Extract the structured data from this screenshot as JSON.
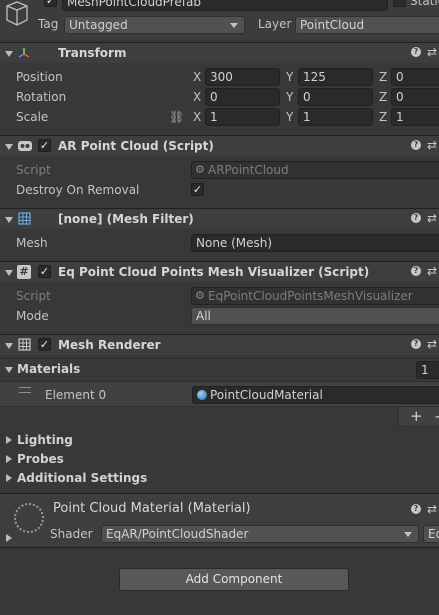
{
  "object": {
    "name": "MeshPointCloudPrefab",
    "static_label": "Static",
    "tag_label": "Tag",
    "tag_value": "Untagged",
    "layer_label": "Layer",
    "layer_value": "PointCloud"
  },
  "transform": {
    "title": "Transform",
    "position_label": "Position",
    "rotation_label": "Rotation",
    "scale_label": "Scale",
    "x": "X",
    "y": "Y",
    "z": "Z",
    "position": [
      "300",
      "125",
      "0"
    ],
    "rotation": [
      "0",
      "0",
      "0"
    ],
    "scale": [
      "1",
      "1",
      "1"
    ]
  },
  "ar_point_cloud": {
    "title": "AR Point Cloud (Script)",
    "script_label": "Script",
    "script_value": "ARPointCloud",
    "destroy_label": "Destroy On Removal",
    "destroy_checked": "✓"
  },
  "mesh_filter": {
    "title": "[none] (Mesh Filter)",
    "mesh_label": "Mesh",
    "mesh_value": "None (Mesh)"
  },
  "visualizer": {
    "title": "Eq Point Cloud Points Mesh Visualizer (Script)",
    "script_label": "Script",
    "script_value": "EqPointCloudPointsMeshVisualizer",
    "mode_label": "Mode",
    "mode_value": "All"
  },
  "mesh_renderer": {
    "title": "Mesh Renderer",
    "materials_label": "Materials",
    "materials_count": "1",
    "element_label": "Element 0",
    "element_value": "PointCloudMaterial",
    "add": "+",
    "remove": "-",
    "lighting": "Lighting",
    "probes": "Probes",
    "additional": "Additional Settings"
  },
  "material": {
    "title": "Point Cloud Material (Material)",
    "shader_label": "Shader",
    "shader_value": "EqAR/PointCloudShader",
    "edit": "Ed"
  },
  "add_component": "Add Component",
  "check": "✓",
  "help": "?",
  "settings": "⇄"
}
